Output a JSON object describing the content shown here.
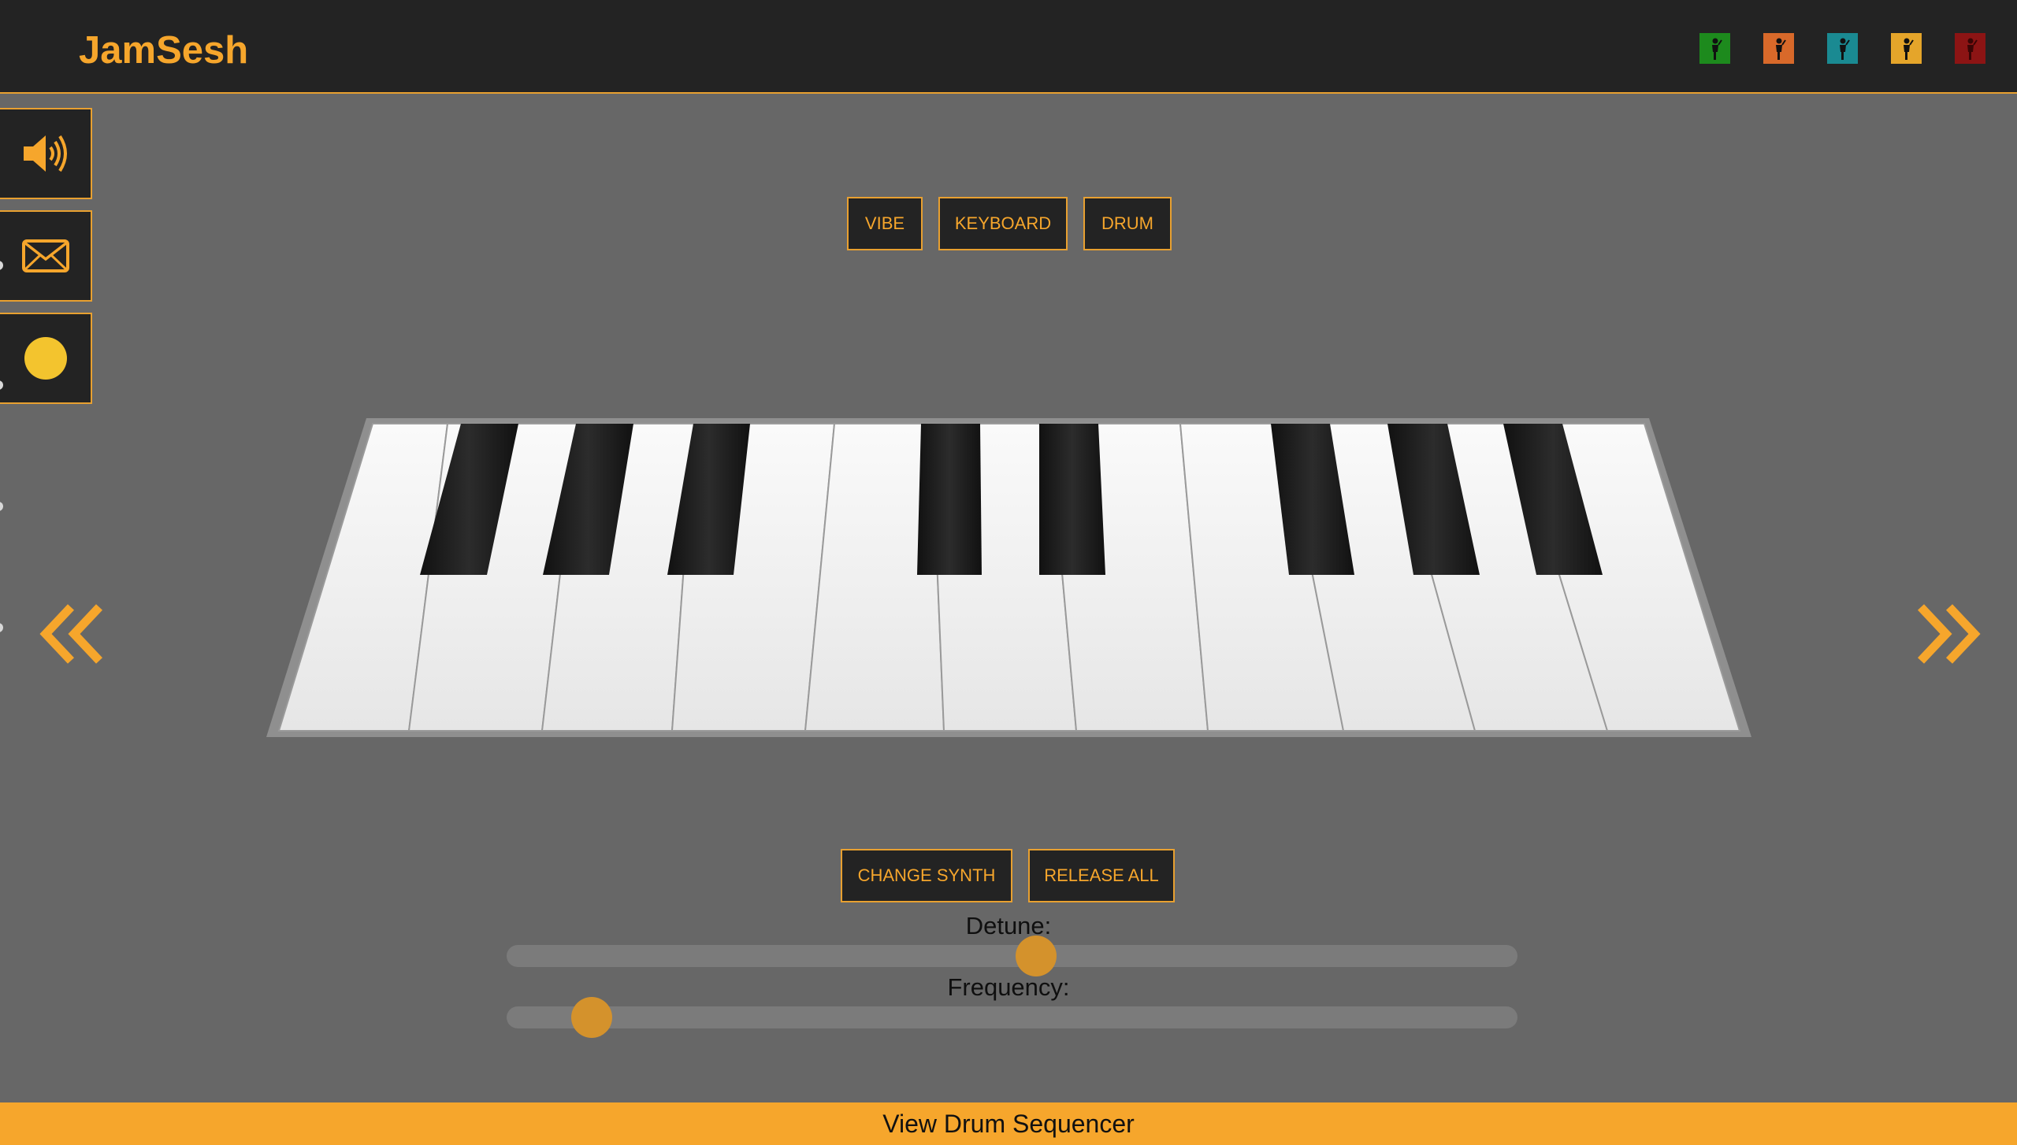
{
  "app": {
    "title": "JamSesh"
  },
  "users": [
    {
      "name": "user-green",
      "color": "#1d8a1d"
    },
    {
      "name": "user-orange",
      "color": "#d8692a"
    },
    {
      "name": "user-teal",
      "color": "#1a8a92"
    },
    {
      "name": "user-yellow",
      "color": "#e5a52a"
    },
    {
      "name": "user-red",
      "color": "#8c1414"
    }
  ],
  "sidebar": {
    "items": [
      {
        "icon": "speaker-icon"
      },
      {
        "icon": "envelope-icon"
      },
      {
        "icon": "status-dot-icon",
        "color": "#f3c42e"
      }
    ]
  },
  "modes": {
    "vibe": "VIBE",
    "keyboard": "KEYBOARD",
    "drum": "DRUM"
  },
  "controls": {
    "change_synth": "CHANGE SYNTH",
    "release_all": "RELEASE ALL"
  },
  "sliders": {
    "detune": {
      "label": "Detune:",
      "value_fraction": 0.525
    },
    "frequency": {
      "label": "Frequency:",
      "value_fraction": 0.067
    }
  },
  "footer": {
    "label": "View Drum Sequencer"
  },
  "colors": {
    "accent": "#f6a62c",
    "panel": "#232323",
    "background": "#676767"
  }
}
